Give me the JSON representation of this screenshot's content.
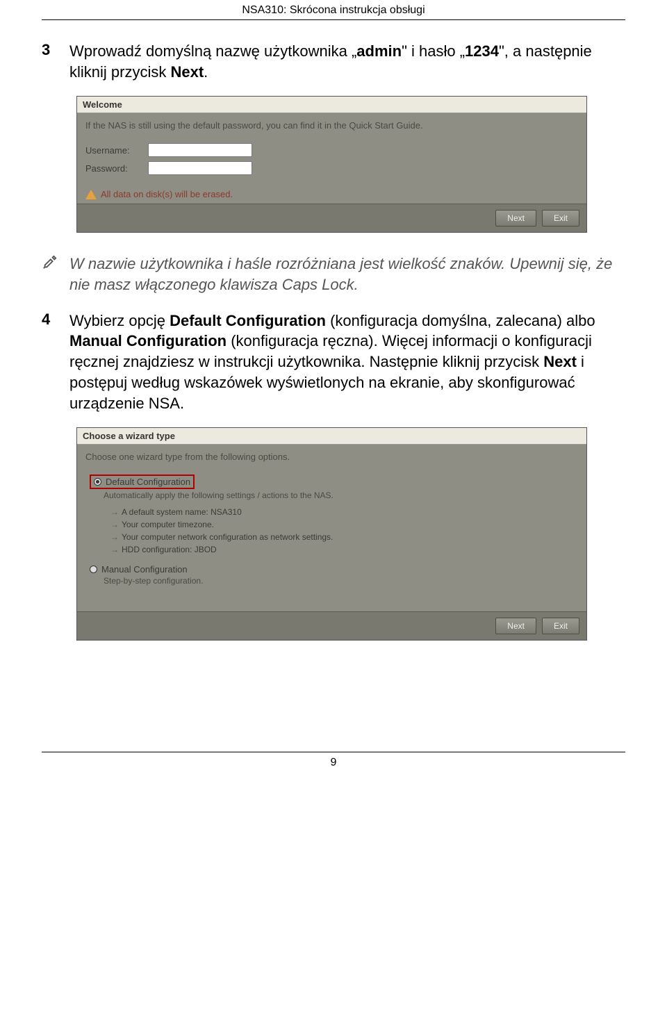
{
  "header": {
    "title": "NSA310: Skrócona instrukcja obsługi"
  },
  "step3": {
    "num": "3",
    "text_pre": "Wprowadź domyślną nazwę użytkownika „",
    "b1": "admin",
    "text_mid1": "\" i hasło „",
    "b2": "1234",
    "text_mid2": "\", a następnie kliknij przycisk ",
    "b3": "Next",
    "text_post": "."
  },
  "note": {
    "text": "W nazwie użytkownika i haśle rozróżniana jest wielkość znaków. Upewnij się, że nie masz włączonego klawisza Caps Lock."
  },
  "step4": {
    "num": "4",
    "t1": "Wybierz opcję ",
    "b1": "Default Configuration",
    "t2": " (konfiguracja domyślna, zalecana) albo ",
    "b2": "Manual Configuration",
    "t3": " (konfiguracja ręczna). Więcej informacji o konfiguracji ręcznej znajdziesz w instrukcji użytkownika. Następnie kliknij przycisk ",
    "b3": "Next",
    "t4": " i postępuj według wskazówek wyświetlonych na ekranie, aby skonfigurować urządzenie NSA."
  },
  "ss1": {
    "title": "Welcome",
    "subtitle": "If the NAS is still using the default password, you can find it in the Quick Start Guide.",
    "username_label": "Username:",
    "password_label": "Password:",
    "warn": "All data on disk(s) will be erased.",
    "next": "Next",
    "exit": "Exit"
  },
  "ss2": {
    "title": "Choose a wizard type",
    "subtitle": "Choose one wizard type from the following options.",
    "opt1": "Default Configuration",
    "opt1_sub": "Automatically apply the following settings / actions to the NAS.",
    "items": [
      "A default system name: NSA310",
      "Your computer timezone.",
      "Your computer network configuration as network settings.",
      "HDD configuration: JBOD"
    ],
    "opt2": "Manual Configuration",
    "opt2_sub": "Step-by-step configuration.",
    "next": "Next",
    "exit": "Exit"
  },
  "footer": {
    "page": "9"
  }
}
